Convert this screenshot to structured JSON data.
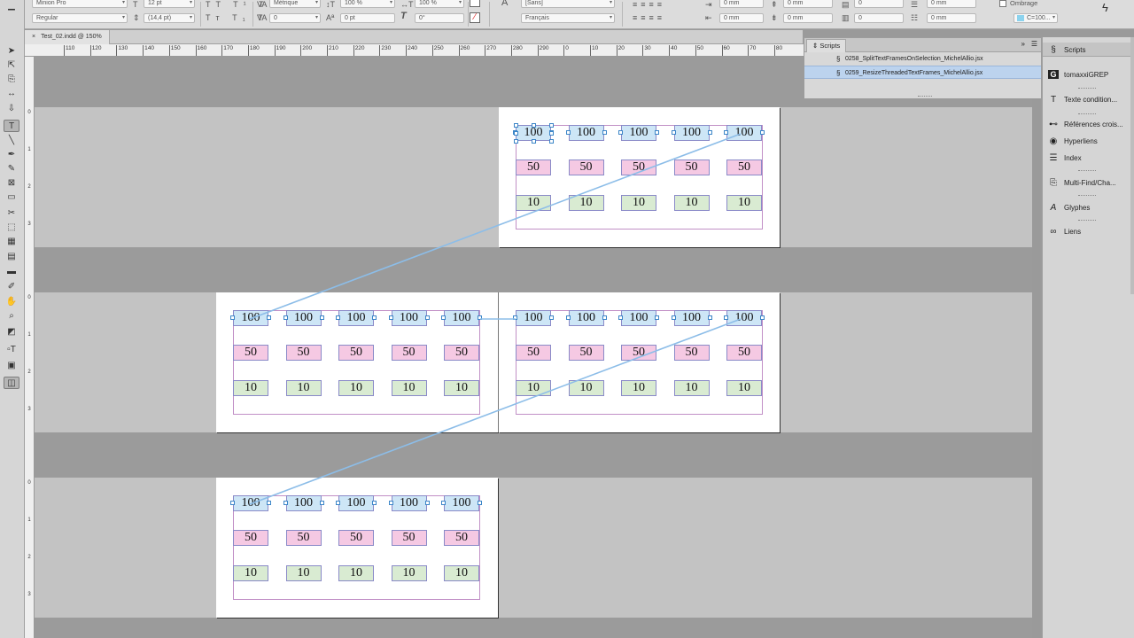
{
  "control_bar": {
    "font_family": "Minion Pro",
    "font_style": "Regular",
    "font_size": "12 pt",
    "leading": "(14,4 pt)",
    "kerning": "Métrique",
    "tracking": "0",
    "vertical_scale": "100 %",
    "horizontal_scale": "100 %",
    "baseline_shift": "0 pt",
    "skew": "0°",
    "character_style": "[Sans]",
    "language": "Français",
    "indent_left": "0 mm",
    "indent_right": "0 mm",
    "space_before": "0 mm",
    "space_after": "0 mm",
    "drop_cap_lines": "0",
    "drop_cap_chars": "0",
    "shading_label": "Ombrage",
    "shading_color": "C=100..."
  },
  "document_tab": {
    "close": "×",
    "title": "Test_02.indd @ 150%"
  },
  "rulers": {
    "horizontal": [
      "110",
      "120",
      "130",
      "140",
      "150",
      "160",
      "170",
      "180",
      "190",
      "200",
      "210",
      "220",
      "230",
      "240",
      "250",
      "260",
      "270",
      "280",
      "290",
      "0",
      "10",
      "20",
      "30",
      "40",
      "50",
      "60",
      "70",
      "80"
    ],
    "vertical_p1": [
      "0",
      "1",
      "2",
      "3"
    ],
    "vertical_p2": [
      "0",
      "1",
      "2",
      "3"
    ],
    "vertical_p3": [
      "0",
      "1",
      "2",
      "3"
    ]
  },
  "grid_values": {
    "row1": "100",
    "row2": "50",
    "row3": "10"
  },
  "scripts_panel": {
    "tab_label": "Scripts",
    "items": [
      "0258_SplitTextFramesOnSelection_MichelAllio.jsx",
      "0259_ResizeThreadedTextFrames_MichelAllio.jsx"
    ]
  },
  "right_panels": [
    {
      "icon": "scripts-icon",
      "label": "Scripts"
    },
    {
      "icon": "grep-icon",
      "label": "tomaxxiGREP"
    },
    {
      "icon": "conditional-text-icon",
      "label": "Texte condition..."
    },
    {
      "icon": "cross-reference-icon",
      "label": "Références crois..."
    },
    {
      "icon": "hyperlinks-icon",
      "label": "Hyperliens"
    },
    {
      "icon": "index-icon",
      "label": "Index"
    },
    {
      "icon": "find-change-icon",
      "label": "Multi-Find/Cha..."
    },
    {
      "icon": "glyphs-icon",
      "label": "Glyphes"
    },
    {
      "icon": "links-icon",
      "label": "Liens"
    }
  ],
  "colors": {
    "frame_100": "#cde6f6",
    "frame_50": "#f5c9e3",
    "frame_10": "#d9ebd2",
    "thread_line": "#8cbde8",
    "margin_guide": "#c18fc6",
    "selected_script": "#bcd3ee"
  }
}
